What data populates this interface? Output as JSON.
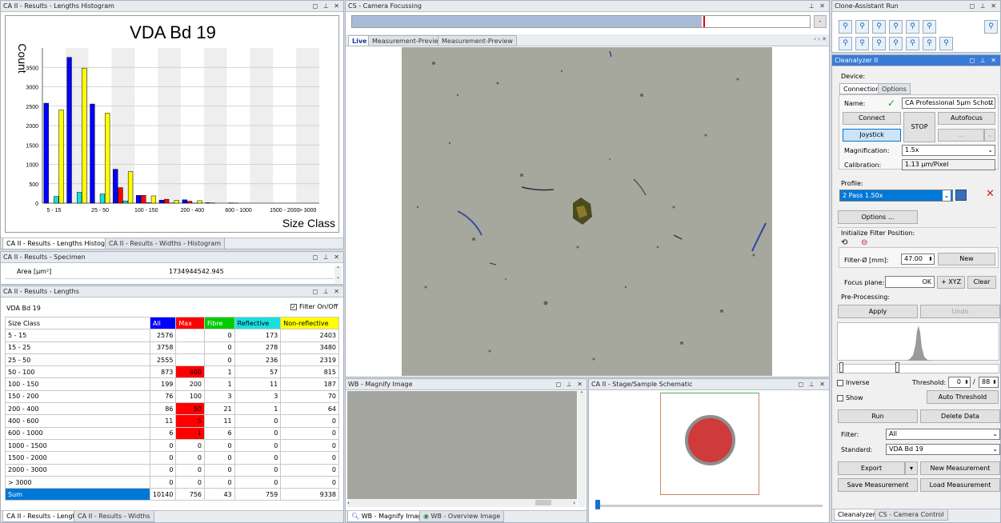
{
  "histogram_panel": {
    "title": "CA II - Results - Lengths Histogram",
    "tabs": [
      "CA II - Results - Lengths Histogram",
      "CA II - Results - Widths - Histogram"
    ]
  },
  "chart_data": {
    "type": "bar",
    "title": "VDA Bd 19",
    "ylabel": "Count",
    "xlabel": "Size Class",
    "categories": [
      "5 - 15",
      "15 - 25",
      "25 - 50",
      "50 - 100",
      "100 - 150",
      "150 - 200",
      "200 - 400",
      "400 - 600",
      "600 - 1000",
      "1000 - 1500",
      "1500 - 2000",
      "> 3000"
    ],
    "tick_labels": [
      "5 - 15",
      "25 - 50",
      "100 - 150",
      "200 - 400",
      "600 - 1000",
      "1500 - 2000",
      "> 3000"
    ],
    "ylim": [
      0,
      4000
    ],
    "yticks": [
      0,
      500,
      1000,
      1500,
      2000,
      2500,
      3000,
      3500
    ],
    "series": [
      {
        "color": "#0000ff",
        "values": [
          2576,
          3758,
          2555,
          873,
          199,
          76,
          86,
          11,
          6,
          0,
          0,
          0
        ]
      },
      {
        "color": "#ff0000",
        "values": [
          0,
          0,
          0,
          400,
          200,
          100,
          50,
          5,
          1,
          0,
          0,
          0
        ]
      },
      {
        "color": "#19e0e0",
        "values": [
          173,
          278,
          236,
          57,
          11,
          3,
          1,
          0,
          0,
          0,
          0,
          0
        ]
      },
      {
        "color": "#ffff00",
        "values": [
          2403,
          3480,
          2319,
          815,
          187,
          70,
          64,
          0,
          0,
          0,
          0,
          0
        ]
      }
    ]
  },
  "specimen": {
    "title": "CA II - Results - Specimen",
    "label": "Area  [µm²]",
    "value": "1734944542.945"
  },
  "lengths": {
    "title": "CA II - Results - Lengths",
    "name": "VDA Bd 19",
    "filter_label": "Filter On/Off",
    "headers": [
      "Size Class",
      "All",
      "Max",
      "Fibre",
      "Reflective",
      "Non-reflective"
    ],
    "rows": [
      [
        "5 - 15",
        "2576",
        "",
        "0",
        "173",
        "2403"
      ],
      [
        "15 - 25",
        "3758",
        "",
        "0",
        "278",
        "3480"
      ],
      [
        "25 - 50",
        "2555",
        "",
        "0",
        "236",
        "2319"
      ],
      [
        "50 - 100",
        "873",
        "400",
        "1",
        "57",
        "815"
      ],
      [
        "100 - 150",
        "199",
        "200",
        "1",
        "11",
        "187"
      ],
      [
        "150 - 200",
        "76",
        "100",
        "3",
        "3",
        "70"
      ],
      [
        "200 - 400",
        "86",
        "50",
        "21",
        "1",
        "64"
      ],
      [
        "400 - 600",
        "11",
        "5",
        "11",
        "0",
        "0"
      ],
      [
        "600 - 1000",
        "6",
        "1",
        "6",
        "0",
        "0"
      ],
      [
        "1000 - 1500",
        "0",
        "0",
        "0",
        "0",
        "0"
      ],
      [
        "1500 - 2000",
        "0",
        "0",
        "0",
        "0",
        "0"
      ],
      [
        "2000 - 3000",
        "0",
        "0",
        "0",
        "0",
        "0"
      ],
      [
        "> 3000",
        "0",
        "0",
        "0",
        "0",
        "0"
      ]
    ],
    "max_exceeded_rows": [
      3,
      6,
      7,
      8
    ],
    "sum": [
      "Sum",
      "10140",
      "756",
      "43",
      "759",
      "9338"
    ],
    "tabs": [
      "CA II - Results - Lengths",
      "CA II - Results - Widths"
    ]
  },
  "camera": {
    "title": "CS - Camera Focussing",
    "tabs": [
      "Live",
      "Measurement-Preview",
      "Measurement-Preview"
    ],
    "focus_button": "-"
  },
  "magnify": {
    "title": "WB - Magnify Image",
    "tabs": [
      "WB - Magnify Image",
      "WB - Overview Image"
    ]
  },
  "stage": {
    "title": "CA II - Stage/Sample Schematic"
  },
  "clone": {
    "title": "Clone-Assistant Run"
  },
  "cleanalyzer": {
    "title": "Cleanalyzer II",
    "device_label": "Device:",
    "tabs": [
      "Connection",
      "Options"
    ],
    "name_label": "Name:",
    "device_name": "CA Professional 5µm Schott",
    "connect": "Connect",
    "stop": "STOP",
    "autofocus": "Autofocus",
    "joystick": "Joystick",
    "ellipsis": "...",
    "magnification_label": "Magnification:",
    "magnification": "1.5x",
    "calibration_label": "Calibration:",
    "calibration": "1.13 µm/Pixel",
    "profile_label": "Profile:",
    "profile": "2 Pass 1.50x",
    "options_button": "Options ...",
    "init_filter_label": "Initialize Filter Position:",
    "filter_d_label": "Filter-Ø [mm]:",
    "filter_d": "47.00",
    "new_button": "New",
    "focus_plane_label": "Focus plane:",
    "ok_button": "OK",
    "xyz_button": "+ XYZ",
    "clear_button": "Clear",
    "preprocessing_label": "Pre-Processing:",
    "apply": "Apply",
    "undo": "Undo",
    "inverse": "Inverse",
    "threshold_label": "Threshold:",
    "threshold_low": "0",
    "threshold_high": "88",
    "show": "Show",
    "auto_threshold": "Auto Threshold",
    "run": "Run",
    "delete_data": "Delete Data",
    "filter_label": "Filter:",
    "filter_value": "All",
    "standard_label": "Standard:",
    "standard_value": "VDA Bd 19",
    "export": "Export",
    "new_measurement": "New Measurement",
    "save_measurement": "Save Measurement",
    "load_measurement": "Load Measurement",
    "bottom_tabs": [
      "Cleanalyzer II",
      "CS - Camera Control"
    ]
  },
  "colors": {
    "all": "#0000ff",
    "max": "#ff0000",
    "fibre": "#00cc00",
    "reflective": "#19e0e0",
    "nonreflective": "#ffff00",
    "sum_bg": "#0078d7"
  }
}
